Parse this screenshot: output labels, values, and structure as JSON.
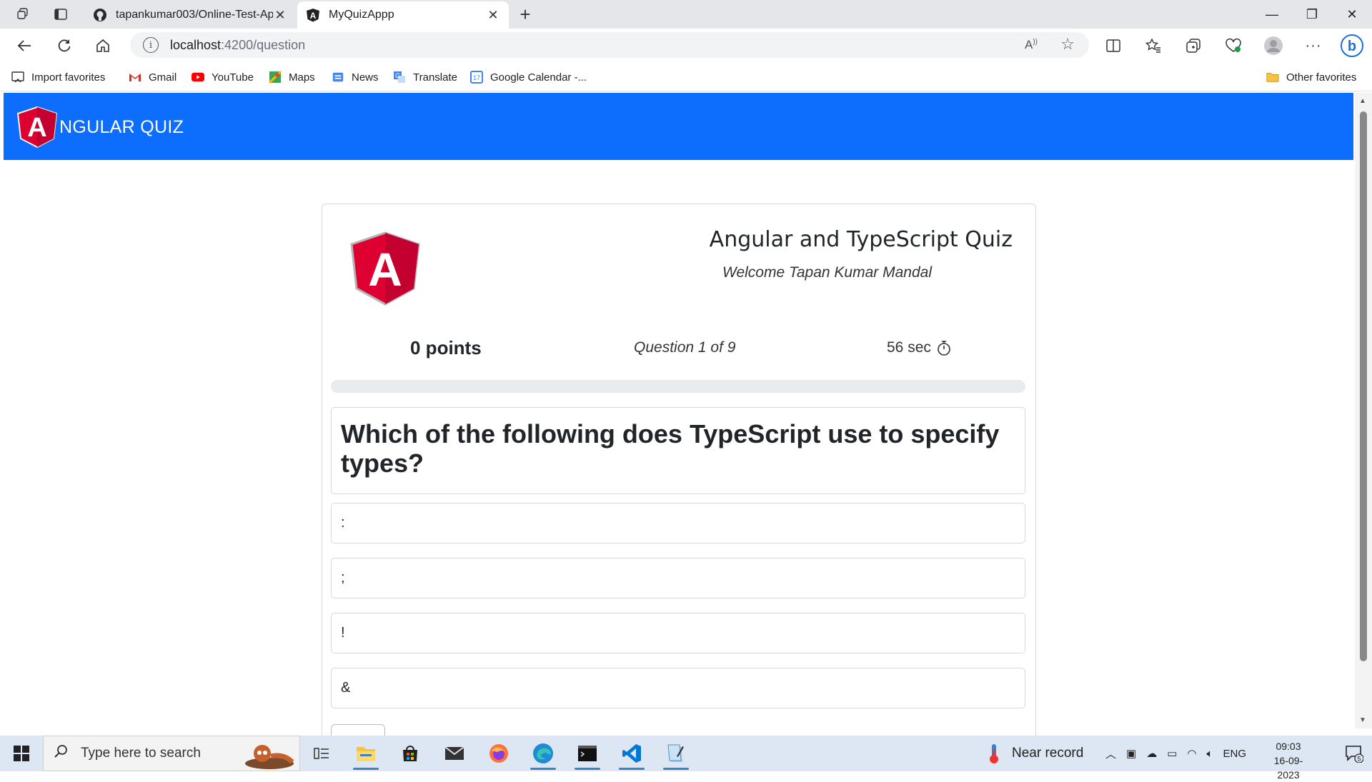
{
  "browser": {
    "tabs": [
      {
        "title": "tapankumar003/Online-Test-App",
        "icon": "github-icon",
        "active": false
      },
      {
        "title": "MyQuizAppp",
        "icon": "angular-icon",
        "active": true
      }
    ],
    "address": {
      "host": "localhost",
      "path": ":4200/question"
    },
    "favorites": [
      {
        "label": "Import favorites",
        "icon": "import-icon"
      },
      {
        "label": "Gmail",
        "icon": "gmail-icon"
      },
      {
        "label": "YouTube",
        "icon": "youtube-icon"
      },
      {
        "label": "Maps",
        "icon": "maps-icon"
      },
      {
        "label": "News",
        "icon": "news-icon"
      },
      {
        "label": "Translate",
        "icon": "translate-icon"
      },
      {
        "label": "Google Calendar -...",
        "icon": "calendar-icon"
      }
    ],
    "other_favorites": "Other favorites",
    "calendar_day": "17"
  },
  "app": {
    "brand_letter": "A",
    "brand_text": "NGULAR QUIZ",
    "accent_color": "#0d6efd"
  },
  "quiz": {
    "logo_letter": "A",
    "title": "Angular and TypeScript Quiz",
    "welcome": "Welcome Tapan Kumar Mandal",
    "points": "0 points",
    "question_counter": "Question 1 of 9",
    "timer": "56 sec",
    "progress_fraction": 0,
    "question": "Which of the following does TypeScript use to specify types?",
    "options": [
      ":",
      ";",
      "!",
      "&"
    ]
  },
  "taskbar": {
    "search_placeholder": "Type here to search",
    "weather": "Near record",
    "language": "ENG",
    "time": "09:03",
    "date": "16-09-2023",
    "notification_count": "5"
  }
}
